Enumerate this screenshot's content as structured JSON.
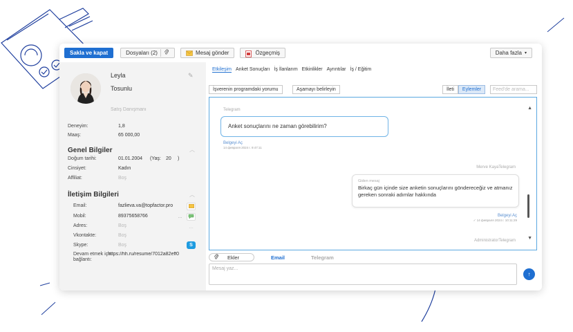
{
  "toolbar": {
    "save_label": "Sakla ve kapat",
    "files_label": "Dosyaları (2)",
    "message_label": "Mesaj gönder",
    "cv_label": "Özgeçmiş",
    "more_label": "Daha fazla"
  },
  "profile": {
    "first_name": "Leyla",
    "last_name": "Tosunlu",
    "position": "Satış Danışmanı",
    "experience_label": "Deneyim:",
    "experience_value": "1,8",
    "salary_label": "Maaş:",
    "salary_value": "65 000,00"
  },
  "general": {
    "title": "Genel Bilgiler",
    "birth_label": "Doğum tarihi:",
    "birth_value": "01.01.2004",
    "age_label": "(Yaş:",
    "age_value": "20",
    "age_close": ")",
    "gender_label": "Cinsiyet:",
    "gender_value": "Kadın",
    "affiliate_label": "Affiliat:",
    "affiliate_value": "Boş"
  },
  "contact": {
    "title": "İletişim Bilgileri",
    "email_label": "Email:",
    "email_value": "fazlieva.va@topfactor.pro",
    "mobile_label": "Mobil:",
    "mobile_value": "89375658766",
    "address_label": "Adres:",
    "address_value": "Boş",
    "vk_label": "Vkontakte:",
    "vk_value": "Boş",
    "skype_label": "Skype:",
    "skype_value": "Boş",
    "apply_label_1": "Devam etmek için",
    "apply_label_2": "bağlantı:",
    "apply_value": "https://hh.ru/resume/7012a82eff0",
    "mobile_more": "..."
  },
  "tabs": [
    "Etkileşim",
    "Anket Sonuçları",
    "İş İlanlarım",
    "Etkinlikler",
    "Ayrıntılar",
    "İş / Eğitim"
  ],
  "actions": {
    "employer_comment": "İşverenin programdaki yorumu",
    "set_stage": "Aşamayı belirleyin",
    "seg_all": "İleti",
    "seg_actions": "Eylemler",
    "feed_placeholder": "Feed'de arama..."
  },
  "chat": {
    "channel_1": "Telegram",
    "incoming_text": "Anket sonuçlarını ne zaman görebilirim?",
    "read_1": "Belgeyi Aç",
    "time_1": "14 февраля 2024 г. 9:47:11",
    "author_2": "Merve KayaTelegram",
    "out_kind": "Giden mesaj",
    "out_text": "Birkaç gün içinde size anketin sonuçlarını göndereceğiz ve atmanız gereken sonraki adımlar hakkında",
    "read_2": "Belgeyi Aç",
    "time_2": "✓ 14 февраля 2024 г. 10:11:29",
    "author_3": "AdministratorTelegram"
  },
  "compose": {
    "attach_label": "Ekler",
    "email_tab": "Email",
    "telegram_tab": "Telegram",
    "placeholder": "Mesaj yaz..."
  },
  "colors": {
    "accent": "#1f6fd1",
    "chat_border": "#5aa7e0",
    "panel_bg": "#f3f3f3"
  }
}
